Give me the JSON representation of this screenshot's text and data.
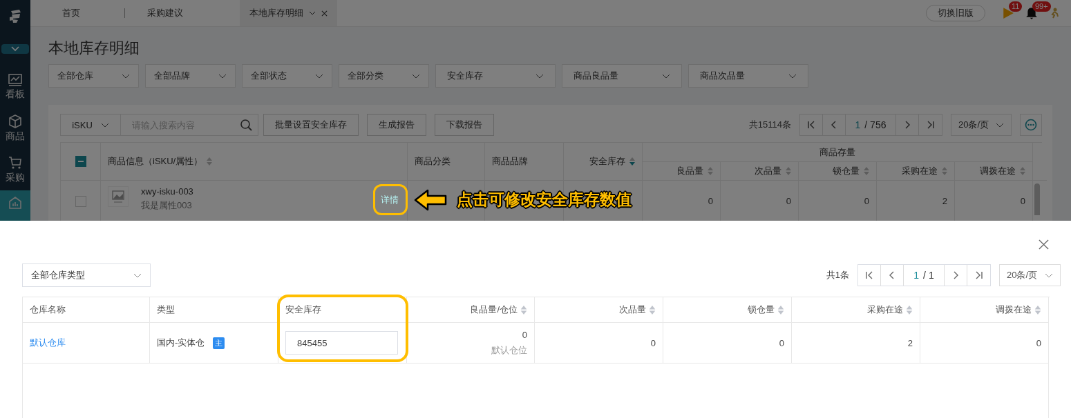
{
  "sidebar": {
    "items": [
      {
        "label": "看板",
        "selected": false
      },
      {
        "label": "商品",
        "selected": false
      },
      {
        "label": "采购",
        "selected": false
      },
      {
        "selected": true
      }
    ]
  },
  "tabs": [
    {
      "label": "首页",
      "selected": false,
      "closable": false
    },
    {
      "label": "采购建议",
      "selected": false,
      "closable": false
    },
    {
      "label": "本地库存明细",
      "selected": true,
      "closable": true
    }
  ],
  "header": {
    "switch_button": "切换旧版",
    "flag_badge": "11",
    "bell_badge": "99+"
  },
  "page_title": "本地库存明细",
  "filters": [
    "全部仓库",
    "全部品牌",
    "全部状态",
    "全部分类",
    "安全库存",
    "商品良品量",
    "商品次品量"
  ],
  "toolbar": {
    "search_type": "iSKU",
    "search_placeholder": "请输入搜索内容",
    "buttons": [
      "批量设置安全库存",
      "生成报告",
      "下载报告"
    ],
    "total": "共15114条",
    "page": "1",
    "pages": "/ 756",
    "page_size": "20条/页"
  },
  "table": {
    "select_all_indeterminate": true,
    "columns": [
      {
        "label": "商品信息（iSKU/属性）",
        "sortable": true,
        "sorted": false
      },
      {
        "label": "商品分类",
        "sortable": false
      },
      {
        "label": "商品品牌",
        "sortable": false
      },
      {
        "label": "安全库存",
        "sortable": true,
        "sorted": true
      }
    ],
    "group": {
      "label": "商品存量",
      "columns": [
        {
          "label": "良品量",
          "sorted": false
        },
        {
          "label": "次品量",
          "sorted": false
        },
        {
          "label": "锁仓量",
          "sorted": false
        },
        {
          "label": "采购在途",
          "sorted": false
        },
        {
          "label": "调拨在途",
          "sorted": false
        }
      ]
    },
    "rows": [
      {
        "checked": false,
        "sku": "xwy-isku-003",
        "attribute": "我是属性003",
        "values": [
          "0",
          "0",
          "0",
          "2",
          "0"
        ]
      }
    ]
  },
  "annotation": {
    "link": "详情",
    "text": "点击可修改安全库存数值"
  },
  "drawer": {
    "filter": "全部仓库类型",
    "total": "共1条",
    "page": "1",
    "pages": "/ 1",
    "page_size": "20条/页",
    "columns": [
      {
        "label": "仓库名称",
        "sortable": false
      },
      {
        "label": "类型",
        "sortable": false
      },
      {
        "label": "安全库存",
        "sortable": false
      },
      {
        "label": "良品量/仓位",
        "sortable": true
      },
      {
        "label": "次品量",
        "sortable": true
      },
      {
        "label": "锁仓量",
        "sortable": true
      },
      {
        "label": "采购在途",
        "sortable": true
      },
      {
        "label": "调拨在途",
        "sortable": true
      }
    ],
    "rows": [
      {
        "warehouse": "默认仓库",
        "type": "国内-实体仓",
        "badge": "主",
        "safety_stock": "845455",
        "good": "0",
        "location": "默认仓位",
        "values": [
          "0",
          "0",
          "2",
          "0"
        ]
      }
    ]
  }
}
